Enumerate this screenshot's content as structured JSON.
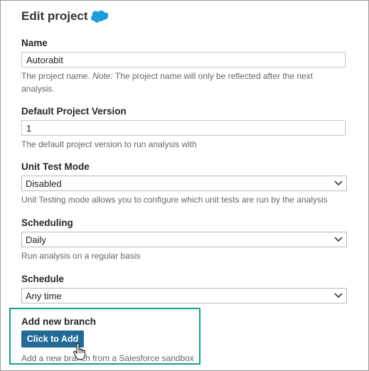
{
  "page": {
    "title": "Edit project",
    "title_icon": "salesforce-cloud-icon"
  },
  "fields": {
    "name": {
      "label": "Name",
      "value": "Autorabit",
      "help_prefix": "The project name.",
      "help_note": "Note:",
      "help_rest": "The project name will only be reflected after the next analysis."
    },
    "version": {
      "label": "Default Project Version",
      "value": "1",
      "help": "The default project version to run analysis with"
    },
    "unit_test_mode": {
      "label": "Unit Test Mode",
      "selected": "Disabled",
      "help": "Unit Testing mode allows you to configure which unit tests are run by the analysis"
    },
    "scheduling": {
      "label": "Scheduling",
      "selected": "Daily",
      "help": "Run analysis on a regular basis"
    },
    "schedule": {
      "label": "Schedule",
      "selected": "Any time"
    }
  },
  "branch": {
    "label": "Add new branch",
    "button_label": "Click to Add",
    "help": "Add a new branch from a Salesforce sandbox"
  },
  "colors": {
    "accent_button": "#236a97",
    "highlight_border": "#1b9e82",
    "salesforce_blue": "#1d9bd9"
  }
}
